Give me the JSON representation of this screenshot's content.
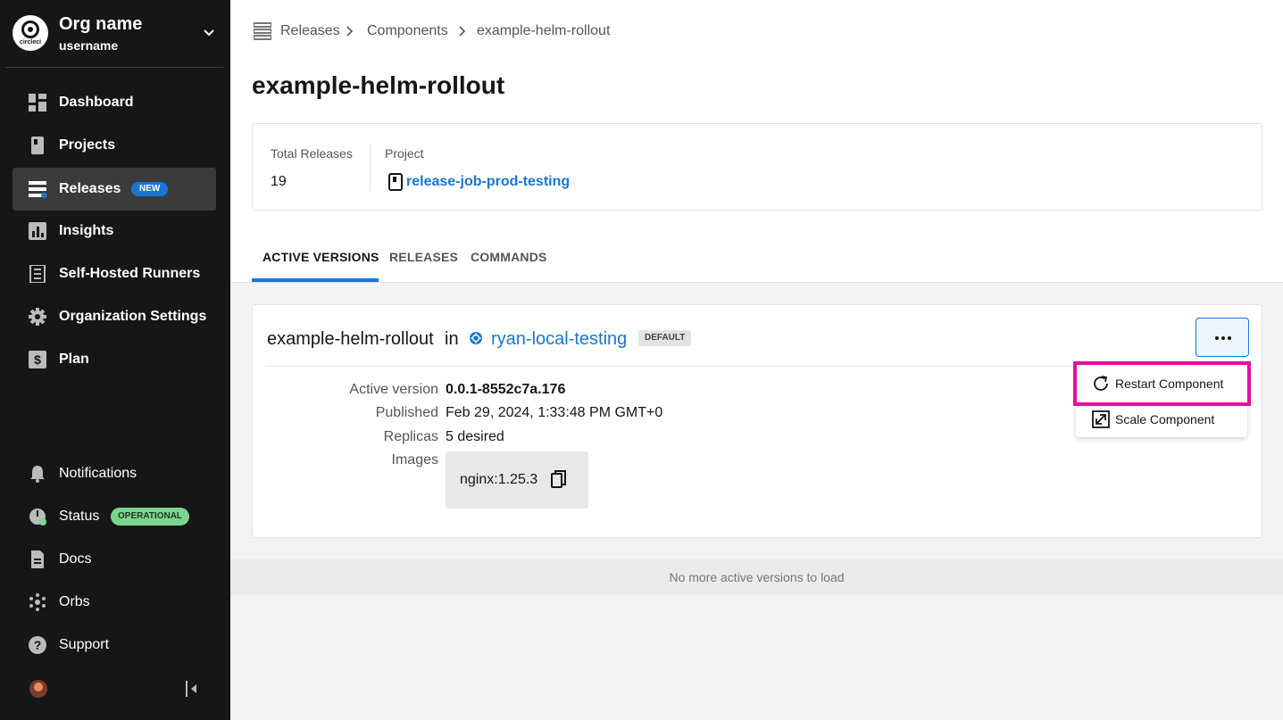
{
  "org": {
    "name": "Org name",
    "username": "username",
    "logo_text": "circleci"
  },
  "nav": {
    "items": [
      {
        "label": "Dashboard",
        "icon": "dashboard-icon"
      },
      {
        "label": "Projects",
        "icon": "projects-icon"
      },
      {
        "label": "Releases",
        "icon": "releases-icon",
        "badge": "NEW",
        "active": true
      },
      {
        "label": "Insights",
        "icon": "insights-icon"
      },
      {
        "label": "Self-Hosted Runners",
        "icon": "runners-icon"
      },
      {
        "label": "Organization Settings",
        "icon": "gear-icon"
      },
      {
        "label": "Plan",
        "icon": "dollar-icon"
      }
    ],
    "bottom": [
      {
        "label": "Notifications",
        "icon": "bell-icon"
      },
      {
        "label": "Status",
        "icon": "status-icon",
        "badge": "OPERATIONAL"
      },
      {
        "label": "Docs",
        "icon": "docs-icon"
      },
      {
        "label": "Orbs",
        "icon": "orbs-icon"
      },
      {
        "label": "Support",
        "icon": "help-icon"
      }
    ]
  },
  "breadcrumb": [
    "Releases",
    "Components",
    "example-helm-rollout"
  ],
  "page_title": "example-helm-rollout",
  "summary": {
    "total_releases_label": "Total Releases",
    "total_releases_value": "19",
    "project_label": "Project",
    "project_value": "release-job-prod-testing"
  },
  "tabs": [
    "ACTIVE VERSIONS",
    "RELEASES",
    "COMMANDS"
  ],
  "component": {
    "name": "example-helm-rollout",
    "in_word": "in",
    "environment": "ryan-local-testing",
    "env_badge": "DEFAULT",
    "fields": {
      "active_version_label": "Active version",
      "active_version_value": "0.0.1-8552c7a.176",
      "published_label": "Published",
      "published_value": "Feb 29, 2024, 1:33:48 PM GMT+0",
      "replicas_label": "Replicas",
      "replicas_value": "5 desired",
      "images_label": "Images",
      "image_value": "nginx:1.25.3"
    }
  },
  "menu": {
    "restart": "Restart Component",
    "scale": "Scale Component"
  },
  "no_more_text": "No more active versions to load",
  "colors": {
    "accent": "#1877d4",
    "highlight": "#e0129a",
    "sidebar_bg": "#161616",
    "operational": "#7dd48e"
  }
}
